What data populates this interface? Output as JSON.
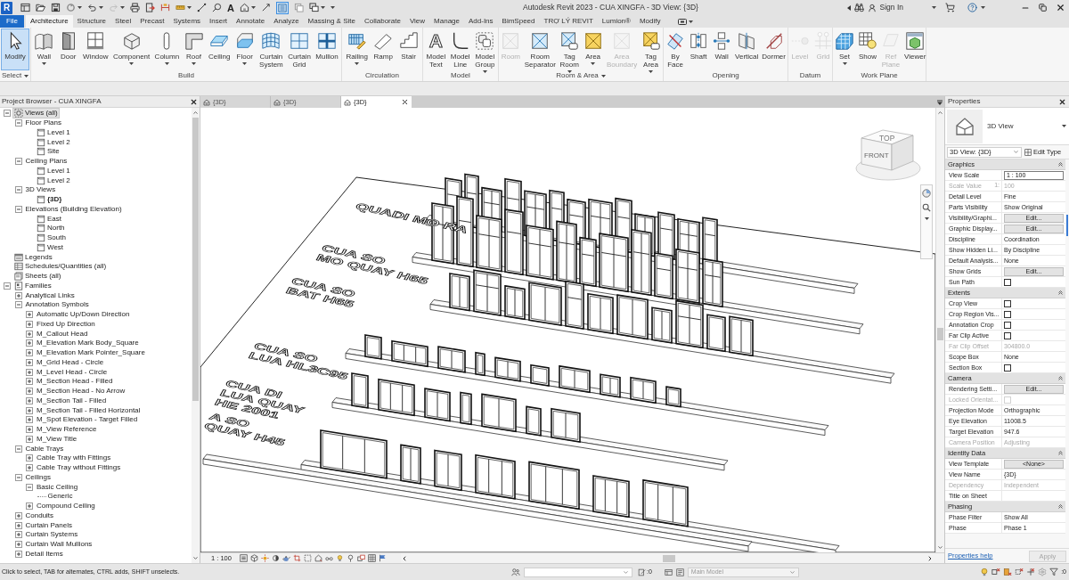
{
  "title_bar": {
    "logo": "R",
    "text_glyph": "A",
    "thin_lines": {
      "on": true
    },
    "title": "Autodesk Revit 2023 - CUA XINGFA - 3D View: {3D}",
    "sign_in": "Sign In"
  },
  "ribbon": {
    "tabs": [
      {
        "label": "File",
        "kind": "file",
        "selected": false
      },
      {
        "label": "Architecture",
        "kind": "tab",
        "selected": true
      },
      {
        "label": "Structure",
        "kind": "tab",
        "selected": false
      },
      {
        "label": "Steel",
        "kind": "tab",
        "selected": false
      },
      {
        "label": "Precast",
        "kind": "tab",
        "selected": false
      },
      {
        "label": "Systems",
        "kind": "tab",
        "selected": false
      },
      {
        "label": "Insert",
        "kind": "tab",
        "selected": false
      },
      {
        "label": "Annotate",
        "kind": "tab",
        "selected": false
      },
      {
        "label": "Analyze",
        "kind": "tab",
        "selected": false
      },
      {
        "label": "Massing & Site",
        "kind": "tab",
        "selected": false
      },
      {
        "label": "Collaborate",
        "kind": "tab",
        "selected": false
      },
      {
        "label": "View",
        "kind": "tab",
        "selected": false
      },
      {
        "label": "Manage",
        "kind": "tab",
        "selected": false
      },
      {
        "label": "Add-Ins",
        "kind": "tab",
        "selected": false
      },
      {
        "label": "BimSpeed",
        "kind": "tab",
        "selected": false
      },
      {
        "label": "TRỢ LÝ REVIT",
        "kind": "tab",
        "selected": false
      },
      {
        "label": "Lumion®",
        "kind": "tab",
        "selected": false
      },
      {
        "label": "Modify",
        "kind": "tab",
        "selected": false
      }
    ],
    "panels": [
      {
        "label": "Select",
        "menu": true,
        "buttons": [
          {
            "label": "Modify",
            "active": true,
            "disabled": false,
            "dropdown": false
          }
        ]
      },
      {
        "label": "Build",
        "menu": false,
        "buttons": [
          {
            "label": "Wall",
            "disabled": false,
            "dropdown": true
          },
          {
            "label": "Door",
            "disabled": false,
            "dropdown": false
          },
          {
            "label": "Window",
            "disabled": false,
            "dropdown": false
          },
          {
            "label": "Component",
            "disabled": false,
            "dropdown": true
          },
          {
            "label": "Column",
            "disabled": false,
            "dropdown": true
          },
          {
            "label": "Roof",
            "disabled": false,
            "dropdown": true
          },
          {
            "label": "Ceiling",
            "disabled": false,
            "dropdown": false
          },
          {
            "label": "Floor",
            "disabled": false,
            "dropdown": true
          },
          {
            "label": "Curtain System",
            "disabled": false,
            "dropdown": false
          },
          {
            "label": "Curtain Grid",
            "disabled": false,
            "dropdown": false
          },
          {
            "label": "Mullion",
            "disabled": false,
            "dropdown": false
          }
        ]
      },
      {
        "label": "Circulation",
        "menu": false,
        "buttons": [
          {
            "label": "Railing",
            "disabled": false,
            "dropdown": true
          },
          {
            "label": "Ramp",
            "disabled": false,
            "dropdown": false
          },
          {
            "label": "Stair",
            "disabled": false,
            "dropdown": false
          }
        ]
      },
      {
        "label": "Model",
        "menu": false,
        "buttons": [
          {
            "label": "Model Text",
            "glyph": "A",
            "disabled": false,
            "dropdown": false
          },
          {
            "label": "Model Line",
            "disabled": false,
            "dropdown": false
          },
          {
            "label": "Model Group",
            "disabled": false,
            "dropdown": true
          }
        ]
      },
      {
        "label": "Room & Area",
        "menu": true,
        "buttons": [
          {
            "label": "Room",
            "disabled": true,
            "dropdown": false
          },
          {
            "label": "Room Separator",
            "disabled": false,
            "dropdown": false
          },
          {
            "label": "Tag Room",
            "disabled": false,
            "dropdown": true
          },
          {
            "label": "Area",
            "disabled": false,
            "dropdown": true
          },
          {
            "label": "Area Boundary",
            "disabled": true,
            "dropdown": false
          },
          {
            "label": "Tag Area",
            "disabled": false,
            "dropdown": true
          }
        ]
      },
      {
        "label": "Opening",
        "menu": false,
        "buttons": [
          {
            "label": "By Face",
            "disabled": false,
            "dropdown": false
          },
          {
            "label": "Shaft",
            "disabled": false,
            "dropdown": false
          },
          {
            "label": "Wall",
            "disabled": false,
            "dropdown": false
          },
          {
            "label": "Vertical",
            "disabled": false,
            "dropdown": false
          },
          {
            "label": "Dormer",
            "disabled": false,
            "dropdown": false
          }
        ]
      },
      {
        "label": "Datum",
        "menu": false,
        "buttons": [
          {
            "label": "Level",
            "disabled": true,
            "dropdown": false
          },
          {
            "label": "Grid",
            "disabled": true,
            "dropdown": false
          }
        ]
      },
      {
        "label": "Work Plane",
        "menu": false,
        "buttons": [
          {
            "label": "Set",
            "disabled": false,
            "dropdown": true
          },
          {
            "label": "Show",
            "disabled": false,
            "dropdown": false
          },
          {
            "label": "Ref Plane",
            "disabled": true,
            "dropdown": false
          },
          {
            "label": "Viewer",
            "disabled": false,
            "dropdown": false
          }
        ]
      }
    ]
  },
  "project_browser": {
    "title": "Project Browser - CUA XINGFA",
    "items": [
      {
        "label": "Views (all)",
        "kind": "views_root",
        "expanded": true,
        "selected": true,
        "children": [
          {
            "label": "Floor Plans",
            "kind": "group",
            "expanded": true,
            "selected": false,
            "children": [
              {
                "label": "Level 1",
                "kind": "view",
                "selected": false,
                "open": false
              },
              {
                "label": "Level 2",
                "kind": "view",
                "selected": false,
                "open": false
              },
              {
                "label": "Site",
                "kind": "view",
                "selected": false,
                "open": false
              }
            ]
          },
          {
            "label": "Ceiling Plans",
            "kind": "group",
            "expanded": true,
            "selected": false,
            "children": [
              {
                "label": "Level 1",
                "kind": "view",
                "selected": false,
                "open": false
              },
              {
                "label": "Level 2",
                "kind": "view",
                "selected": false,
                "open": false
              }
            ]
          },
          {
            "label": "3D Views",
            "kind": "group",
            "expanded": true,
            "selected": false,
            "children": [
              {
                "label": "{3D}",
                "kind": "view",
                "selected": false,
                "open": true
              }
            ]
          },
          {
            "label": "Elevations (Building Elevation)",
            "kind": "group",
            "expanded": true,
            "selected": false,
            "children": [
              {
                "label": "East",
                "kind": "view",
                "selected": false,
                "open": false
              },
              {
                "label": "North",
                "kind": "view",
                "selected": false,
                "open": false
              },
              {
                "label": "South",
                "kind": "view",
                "selected": false,
                "open": false
              },
              {
                "label": "West",
                "kind": "view",
                "selected": false,
                "open": false
              }
            ]
          }
        ]
      },
      {
        "label": "Legends",
        "kind": "legends",
        "selected": false
      },
      {
        "label": "Schedules/Quantities (all)",
        "kind": "schedules",
        "selected": false
      },
      {
        "label": "Sheets (all)",
        "kind": "sheets",
        "selected": false
      },
      {
        "label": "Families",
        "kind": "families",
        "expanded": true,
        "selected": false,
        "children": [
          {
            "label": "Analytical Links",
            "kind": "group",
            "expanded": false,
            "selected": false
          },
          {
            "label": "Annotation Symbols",
            "kind": "group",
            "expanded": true,
            "selected": false,
            "children": [
              {
                "label": "Automatic Up/Down Direction",
                "kind": "group",
                "expanded": false,
                "selected": false
              },
              {
                "label": "Fixed Up Direction",
                "kind": "group",
                "expanded": false,
                "selected": false
              },
              {
                "label": "M_Callout Head",
                "kind": "group",
                "expanded": false,
                "selected": false
              },
              {
                "label": "M_Elevation Mark Body_Square",
                "kind": "group",
                "expanded": false,
                "selected": false
              },
              {
                "label": "M_Elevation Mark Pointer_Square",
                "kind": "group",
                "expanded": false,
                "selected": false
              },
              {
                "label": "M_Grid Head - Circle",
                "kind": "group",
                "expanded": false,
                "selected": false
              },
              {
                "label": "M_Level Head - Circle",
                "kind": "group",
                "expanded": false,
                "selected": false
              },
              {
                "label": "M_Section Head - Filled",
                "kind": "group",
                "expanded": false,
                "selected": false
              },
              {
                "label": "M_Section Head - No Arrow",
                "kind": "group",
                "expanded": false,
                "selected": false
              },
              {
                "label": "M_Section Tail - Filled",
                "kind": "group",
                "expanded": false,
                "selected": false
              },
              {
                "label": "M_Section Tail - Filled Horizontal",
                "kind": "group",
                "expanded": false,
                "selected": false
              },
              {
                "label": "M_Spot Elevation - Target Filled",
                "kind": "group",
                "expanded": false,
                "selected": false
              },
              {
                "label": "M_View Reference",
                "kind": "group",
                "expanded": false,
                "selected": false
              },
              {
                "label": "M_View Title",
                "kind": "group",
                "expanded": false,
                "selected": false
              }
            ]
          },
          {
            "label": "Cable Trays",
            "kind": "group",
            "expanded": true,
            "selected": false,
            "children": [
              {
                "label": "Cable Tray with Fittings",
                "kind": "group",
                "expanded": false,
                "selected": false
              },
              {
                "label": "Cable Tray without Fittings",
                "kind": "group",
                "expanded": false,
                "selected": false
              }
            ]
          },
          {
            "label": "Ceilings",
            "kind": "group",
            "expanded": true,
            "selected": false,
            "children": [
              {
                "label": "Basic Ceiling",
                "kind": "group",
                "expanded": true,
                "selected": false,
                "children": [
                  {
                    "label": "Generic",
                    "kind": "type",
                    "selected": false
                  }
                ]
              },
              {
                "label": "Compound Ceiling",
                "kind": "group",
                "expanded": false,
                "selected": false
              }
            ]
          },
          {
            "label": "Conduits",
            "kind": "group",
            "expanded": false,
            "selected": false
          },
          {
            "label": "Curtain Panels",
            "kind": "group",
            "expanded": false,
            "selected": false
          },
          {
            "label": "Curtain Systems",
            "kind": "group",
            "expanded": false,
            "selected": false
          },
          {
            "label": "Curtain Wall Mullions",
            "kind": "group",
            "expanded": false,
            "selected": false
          },
          {
            "label": "Detail Items",
            "kind": "group",
            "expanded": false,
            "selected": false
          }
        ]
      }
    ]
  },
  "view_tabs": [
    {
      "label": "{3D}",
      "selected": false
    },
    {
      "label": "{3D}",
      "selected": false
    },
    {
      "label": "{3D}",
      "selected": true
    }
  ],
  "view_cube": {
    "top": "TOP",
    "front": "FRONT"
  },
  "model_texts": [
    {
      "lines": [
        "QUADI MO RA"
      ]
    },
    {
      "lines": [
        "CUA SO",
        "MO QUAY H65"
      ]
    },
    {
      "lines": [
        "CUA SO",
        "BAT H65"
      ]
    },
    {
      "lines": [
        "CUA SO",
        "LUA HL3C95"
      ]
    },
    {
      "lines": [
        "CUA DI",
        "LUA QUAY",
        "HE 2001"
      ]
    },
    {
      "lines": [
        "A SO",
        "QUAY H45"
      ]
    }
  ],
  "view_control_bar": {
    "scale": "1 : 100"
  },
  "properties": {
    "title": "Properties",
    "type": "3D View",
    "instance": "3D View: {3D}",
    "edit_type": "Edit Type",
    "sections": [
      {
        "title": "Graphics",
        "expanded": true,
        "rows": [
          {
            "label": "View Scale",
            "kind": "input",
            "value": "1 : 100",
            "disabled": false
          },
          {
            "label": "Scale Value",
            "suffix": "1:",
            "kind": "text",
            "value": "100",
            "disabled": true
          },
          {
            "label": "Detail Level",
            "kind": "text",
            "value": "Fine",
            "disabled": false
          },
          {
            "label": "Parts Visibility",
            "kind": "text",
            "value": "Show Original",
            "disabled": false
          },
          {
            "label": "Visibility/Graphi...",
            "kind": "button",
            "value": "Edit...",
            "disabled": false
          },
          {
            "label": "Graphic Display...",
            "kind": "button",
            "value": "Edit...",
            "disabled": false
          },
          {
            "label": "Discipline",
            "kind": "text",
            "value": "Coordination",
            "disabled": false
          },
          {
            "label": "Show Hidden Li...",
            "kind": "text",
            "value": "By Discipline",
            "disabled": false
          },
          {
            "label": "Default Analysis...",
            "kind": "text",
            "value": "None",
            "disabled": false
          },
          {
            "label": "Show Grids",
            "kind": "button",
            "value": "Edit...",
            "disabled": false
          },
          {
            "label": "Sun Path",
            "kind": "checkbox",
            "checked": false,
            "disabled": false
          }
        ]
      },
      {
        "title": "Extents",
        "expanded": true,
        "rows": [
          {
            "label": "Crop View",
            "kind": "checkbox",
            "checked": false,
            "disabled": false
          },
          {
            "label": "Crop Region Vis...",
            "kind": "checkbox",
            "checked": false,
            "disabled": false
          },
          {
            "label": "Annotation Crop",
            "kind": "checkbox",
            "checked": false,
            "disabled": false
          },
          {
            "label": "Far Clip Active",
            "kind": "checkbox",
            "checked": false,
            "disabled": false
          },
          {
            "label": "Far Clip Offset",
            "kind": "text",
            "value": "304800.0",
            "disabled": true
          },
          {
            "label": "Scope Box",
            "kind": "text",
            "value": "None",
            "disabled": false
          },
          {
            "label": "Section Box",
            "kind": "checkbox",
            "checked": false,
            "disabled": false
          }
        ]
      },
      {
        "title": "Camera",
        "expanded": true,
        "rows": [
          {
            "label": "Rendering Setti...",
            "kind": "button",
            "value": "Edit...",
            "disabled": false
          },
          {
            "label": "Locked Orientat...",
            "kind": "checkbox",
            "checked": false,
            "disabled": true
          },
          {
            "label": "Projection Mode",
            "kind": "text",
            "value": "Orthographic",
            "disabled": false
          },
          {
            "label": "Eye Elevation",
            "kind": "text",
            "value": "11008.5",
            "disabled": false
          },
          {
            "label": "Target Elevation",
            "kind": "text",
            "value": "947.6",
            "disabled": false
          },
          {
            "label": "Camera Position",
            "kind": "text",
            "value": "Adjusting",
            "disabled": true
          }
        ]
      },
      {
        "title": "Identity Data",
        "expanded": true,
        "rows": [
          {
            "label": "View Template",
            "kind": "button",
            "value": "<None>",
            "disabled": false
          },
          {
            "label": "View Name",
            "kind": "text",
            "value": "{3D}",
            "disabled": false
          },
          {
            "label": "Dependency",
            "kind": "text",
            "value": "Independent",
            "disabled": true
          },
          {
            "label": "Title on Sheet",
            "kind": "text",
            "disabled": false
          }
        ]
      },
      {
        "title": "Phasing",
        "expanded": true,
        "rows": [
          {
            "label": "Phase Filter",
            "kind": "text",
            "value": "Show All",
            "disabled": false
          },
          {
            "label": "Phase",
            "kind": "text",
            "value": "Phase 1",
            "disabled": false
          }
        ]
      }
    ],
    "help": "Properties help",
    "apply": {
      "label": "Apply",
      "disabled": true
    }
  },
  "status_bar": {
    "message": "Click to select, TAB for alternates, CTRL adds, SHIFT unselects.",
    "selection_count": ":0",
    "design_option": "Main Model",
    "filter_count": ":0"
  }
}
